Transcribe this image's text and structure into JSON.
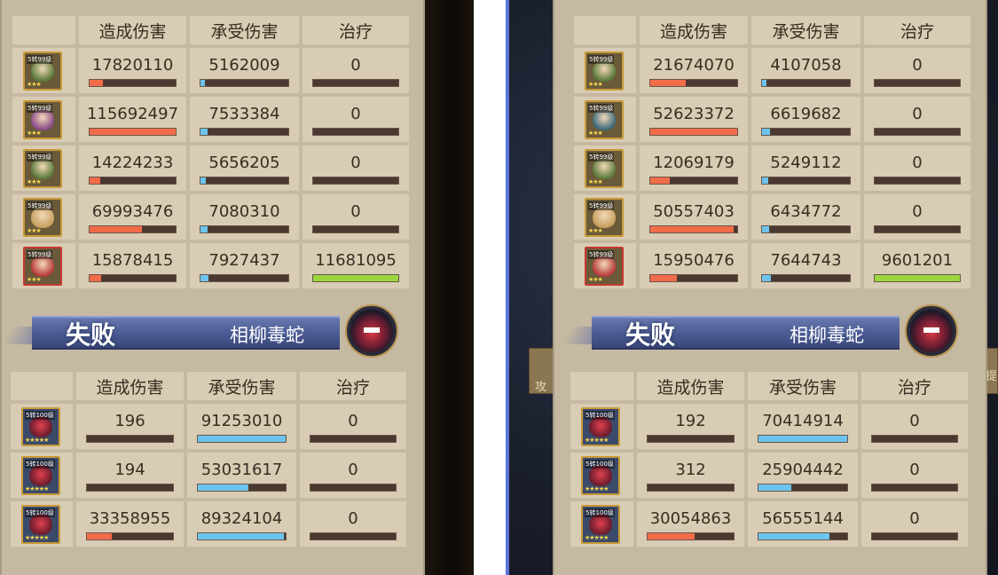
{
  "headers": [
    "造成伤害",
    "承受伤害",
    "治疗"
  ],
  "panels": [
    {
      "team": [
        {
          "dealt": "17820110",
          "taken": "5162009",
          "heal": "0",
          "dealt_fill": 0.154,
          "taken_fill": 0.05,
          "heal_fill": 0,
          "portrait_color": "#5a7a3a",
          "frame": "gold",
          "level_text": "5转99级"
        },
        {
          "dealt": "115692497",
          "taken": "7533384",
          "heal": "0",
          "dealt_fill": 1.0,
          "taken_fill": 0.083,
          "heal_fill": 0,
          "portrait_color": "#8a4a8a",
          "frame": "gold",
          "level_text": "5转99级"
        },
        {
          "dealt": "14224233",
          "taken": "5656205",
          "heal": "0",
          "dealt_fill": 0.123,
          "taken_fill": 0.06,
          "heal_fill": 0,
          "portrait_color": "#5a7a3a",
          "frame": "gold",
          "level_text": "5转99级"
        },
        {
          "dealt": "69993476",
          "taken": "7080310",
          "heal": "0",
          "dealt_fill": 0.605,
          "taken_fill": 0.078,
          "heal_fill": 0,
          "portrait_color": "#c8a060",
          "frame": "gold",
          "level_text": "5转99级"
        },
        {
          "dealt": "15878415",
          "taken": "7927437",
          "heal": "11681095",
          "dealt_fill": 0.137,
          "taken_fill": 0.089,
          "heal_fill": 1.0,
          "portrait_color": "#b83a3a",
          "frame": "red",
          "level_text": "5转99级"
        }
      ],
      "result": "失败",
      "enemy_name": "相柳毒蛇",
      "enemies": [
        {
          "dealt": "196",
          "taken": "91253010",
          "heal": "0",
          "dealt_fill": 0,
          "taken_fill": 1.0,
          "heal_fill": 0,
          "level_text": "5转100级"
        },
        {
          "dealt": "194",
          "taken": "53031617",
          "heal": "0",
          "dealt_fill": 0,
          "taken_fill": 0.58,
          "heal_fill": 0,
          "level_text": "5转100级"
        },
        {
          "dealt": "33358955",
          "taken": "89324104",
          "heal": "0",
          "dealt_fill": 0.29,
          "taken_fill": 0.98,
          "heal_fill": 0,
          "level_text": "5转100级"
        }
      ]
    },
    {
      "team": [
        {
          "dealt": "21674070",
          "taken": "4107058",
          "heal": "0",
          "dealt_fill": 0.412,
          "taken_fill": 0.054,
          "heal_fill": 0,
          "portrait_color": "#5a7a3a",
          "frame": "gold",
          "level_text": "5转99级"
        },
        {
          "dealt": "52623372",
          "taken": "6619682",
          "heal": "0",
          "dealt_fill": 1.0,
          "taken_fill": 0.087,
          "heal_fill": 0,
          "portrait_color": "#3a6a7a",
          "frame": "gold",
          "level_text": "5转99级"
        },
        {
          "dealt": "12069179",
          "taken": "5249112",
          "heal": "0",
          "dealt_fill": 0.229,
          "taken_fill": 0.069,
          "heal_fill": 0,
          "portrait_color": "#5a7a3a",
          "frame": "gold",
          "level_text": "5转99级"
        },
        {
          "dealt": "50557403",
          "taken": "6434772",
          "heal": "0",
          "dealt_fill": 0.961,
          "taken_fill": 0.085,
          "heal_fill": 0,
          "portrait_color": "#c8a060",
          "frame": "gold",
          "level_text": "5转99级"
        },
        {
          "dealt": "15950476",
          "taken": "7644743",
          "heal": "9601201",
          "dealt_fill": 0.303,
          "taken_fill": 0.1,
          "heal_fill": 1.0,
          "portrait_color": "#b83a3a",
          "frame": "red",
          "level_text": "5转99级"
        }
      ],
      "result": "失败",
      "enemy_name": "相柳毒蛇",
      "enemies": [
        {
          "dealt": "192",
          "taken": "70414914",
          "heal": "0",
          "dealt_fill": 0,
          "taken_fill": 1.0,
          "heal_fill": 0,
          "level_text": "5转100级"
        },
        {
          "dealt": "312",
          "taken": "25904442",
          "heal": "0",
          "dealt_fill": 0,
          "taken_fill": 0.37,
          "heal_fill": 0,
          "level_text": "5转100级"
        },
        {
          "dealt": "30054863",
          "taken": "56555144",
          "heal": "0",
          "dealt_fill": 0.55,
          "taken_fill": 0.8,
          "heal_fill": 0,
          "level_text": "5转100级"
        }
      ]
    }
  ],
  "background_glyphs": {
    "left": "攻",
    "right": "提"
  },
  "colors": {
    "damage_dealt": "#f26c4a",
    "damage_taken": "#6cc4ee",
    "healing": "#9ad63c",
    "bar_empty": "#4a3930",
    "panel": "#c6b9a2",
    "cell": "#d8ccb4",
    "banner": "#4c5c94"
  }
}
